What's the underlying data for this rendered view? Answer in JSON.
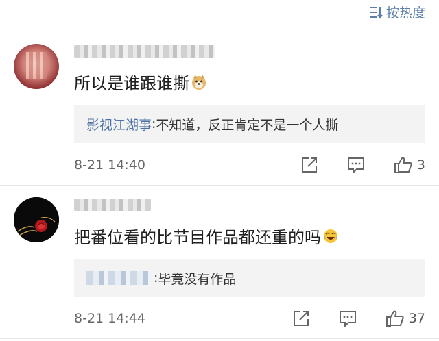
{
  "sort": {
    "label": "按热度",
    "icon": "sort-list-icon"
  },
  "comments": [
    {
      "text": "所以是谁跟谁撕",
      "emoji": "doge-emoji",
      "reply": {
        "author": "影视江湖事",
        "separator": ": ",
        "text": "不知道，反正肯定不是一个人撕"
      },
      "time": "8-21 14:40",
      "likes": "3"
    },
    {
      "text": "把番位看的比节目作品都还重的吗",
      "emoji": "laugh-cry-emoji",
      "reply": {
        "separator": ": ",
        "text": "毕竟没有作品"
      },
      "time": "8-21 14:44",
      "likes": "37"
    }
  ],
  "colors": {
    "link": "#4e74a6",
    "sort": "#5b7fa8",
    "reply_bg": "#f3f3f3"
  }
}
